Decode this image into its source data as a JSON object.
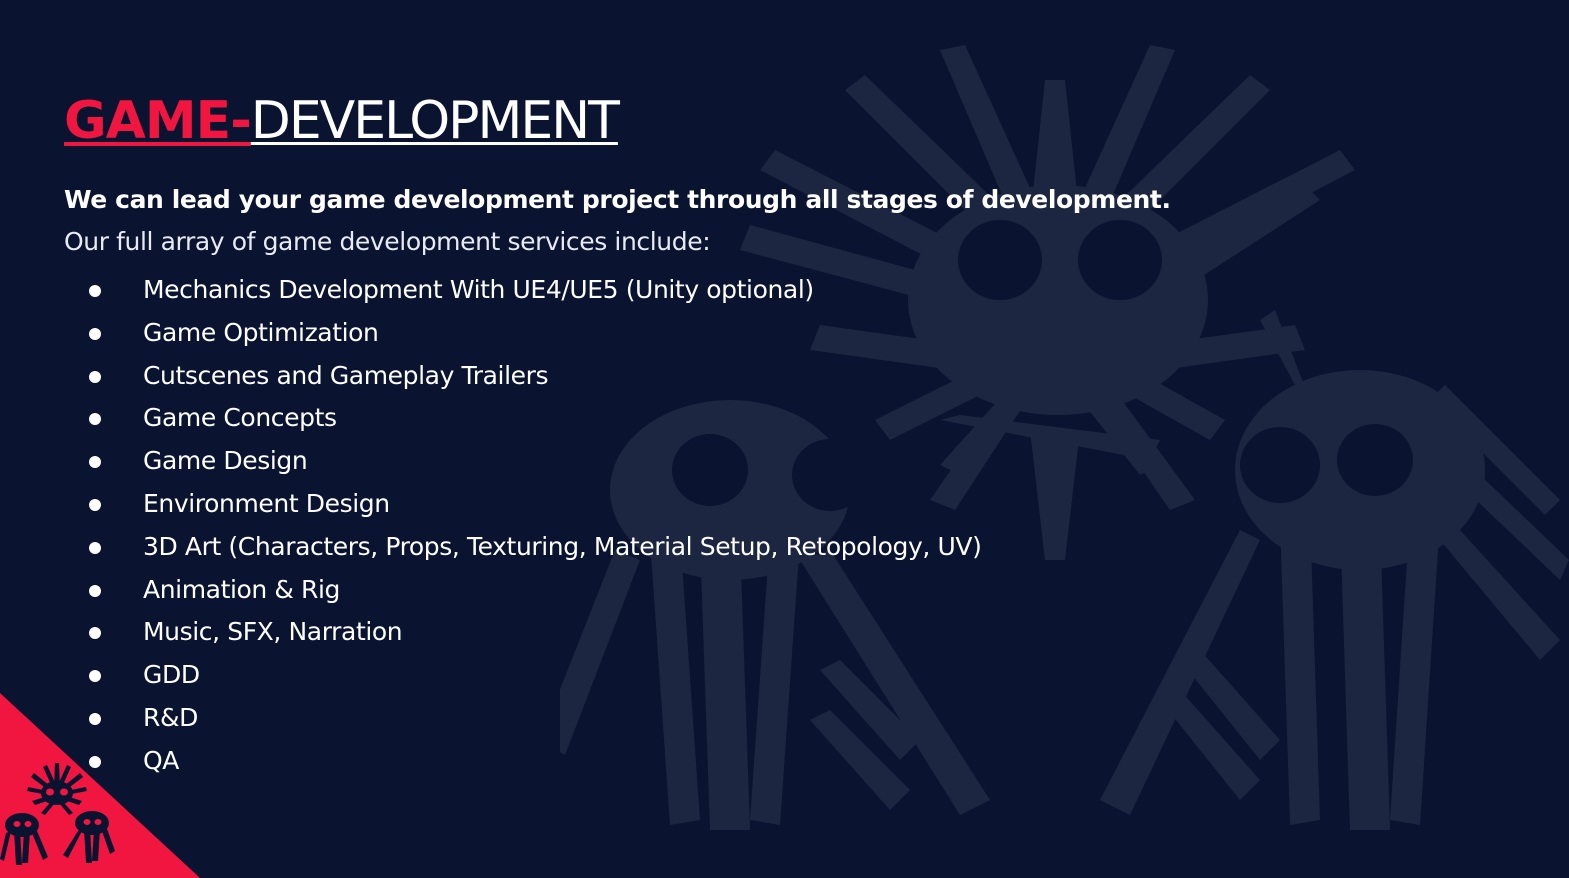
{
  "slide": {
    "title_accent": "GAME-",
    "title_rest": "DEVELOPMENT",
    "lead": "We can lead your game development project through all stages of development.",
    "intro": "Our full array of game development services include:",
    "services": [
      "Mechanics Development With UE4/UE5 (Unity optional)",
      "Game Optimization",
      "Cutscenes and Gameplay Trailers",
      "Game Concepts",
      "Game Design",
      "Environment Design",
      "3D Art (Characters, Props, Texturing, Material Setup, Retopology, UV)",
      "Animation & Rig",
      "Music, SFX, Narration",
      "GDD",
      "R&D",
      "QA"
    ]
  },
  "colors": {
    "background": "#0a1330",
    "accent": "#f0163f",
    "text": "#ffffff",
    "watermark": "#1c2640"
  },
  "icons": {
    "watermark": "spiky-creatures-logo-icon",
    "corner_logo": "spiky-creatures-logo-icon"
  }
}
